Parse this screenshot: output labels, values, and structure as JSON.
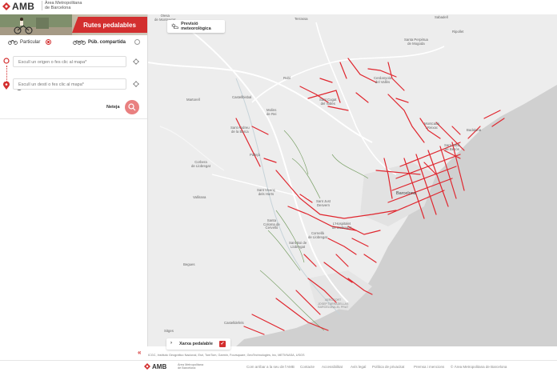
{
  "header": {
    "logo_text": "AMB",
    "logo_sub_line1": "Àrea Metropolitana",
    "logo_sub_line2": "de Barcelona"
  },
  "sidebar": {
    "title": "Rutes pedalables",
    "mode_private": "Particular",
    "mode_shared": "Púb. compartida",
    "origin_placeholder": "Escull un origen o fes clic al mapa*",
    "destination_placeholder": "Escull un destí o fes clic al mapa*",
    "clear_label": "Neteja",
    "collapse_glyph": "«"
  },
  "map": {
    "weather_label": "Previsió meteorològica",
    "layer_label": "Xarxa pedalable",
    "layer_checked": true,
    "route_color": "#e0262e",
    "places": [
      {
        "id": "olesa",
        "text": "Olesa\nde Montserrat"
      },
      {
        "id": "terrassa",
        "text": "Terrassa"
      },
      {
        "id": "sabadell",
        "text": "Sabadell"
      },
      {
        "id": "ripollet",
        "text": "Ripollet"
      },
      {
        "id": "rubi",
        "text": "Rubí"
      },
      {
        "id": "castellbisbal",
        "text": "Castellbisbal"
      },
      {
        "id": "martorell",
        "text": "Martorell"
      },
      {
        "id": "santcugat",
        "text": "Sant Cugat\ndel Vallès"
      },
      {
        "id": "cerdanyola",
        "text": "Cerdanyola\ndel Vallès"
      },
      {
        "id": "sbarbera",
        "text": "Santa Perpètua\nde Mogoda"
      },
      {
        "id": "montcada",
        "text": "Montcada\ni Reixac"
      },
      {
        "id": "badalona",
        "text": "Badalona"
      },
      {
        "id": "santadria",
        "text": "Sant Adrià\nde Besòs"
      },
      {
        "id": "molins",
        "text": "Molins\nde Rei"
      },
      {
        "id": "pallejà",
        "text": "Pallejà"
      },
      {
        "id": "sant-andreu-barca",
        "text": "Sant Andreu\nde la Barca"
      },
      {
        "id": "corbera",
        "text": "Corbera\nde Llobregat"
      },
      {
        "id": "vallirana",
        "text": "Vallirana"
      },
      {
        "id": "santvicenc",
        "text": "Sant Vicenç\ndels Horts"
      },
      {
        "id": "santjust",
        "text": "Sant Just\nDesvern"
      },
      {
        "id": "barcelona",
        "text": "Barcelona"
      },
      {
        "id": "hospitalet",
        "text": "L'Hospitalet\nde Llobregat"
      },
      {
        "id": "cornella",
        "text": "Cornellà\nde Llobregat"
      },
      {
        "id": "santboi",
        "text": "Sant Boi de\nLlobregat"
      },
      {
        "id": "santacoloma",
        "text": "Santa\nColoma de\nCervelló"
      },
      {
        "id": "begues",
        "text": "Begues"
      },
      {
        "id": "castelldefels",
        "text": "Castelldefels"
      },
      {
        "id": "sitges",
        "text": "Sitges"
      },
      {
        "id": "aeroport",
        "text": "AEROPORT\nJOSEP TARRADELLAS\nBARCELONA-EL PRAT"
      }
    ]
  },
  "attribution": "ICGC, Instituto Geográfico Nacional, Esri, TomTom, Garmin, Foursquare, GeoTechnologies, Inc, METI/NASA, USGS",
  "footer": {
    "logo_text": "AMB",
    "logo_sub_line1": "Àrea Metropolitana",
    "logo_sub_line2": "de Barcelona",
    "links": [
      "Com arribar a la seu de l'AMB",
      "Contacte",
      "Accessibilitat",
      "Avís legal",
      "Política de privacitat",
      "Premsa i mencions",
      "© Àrea Metropolitana de Barcelona"
    ]
  }
}
